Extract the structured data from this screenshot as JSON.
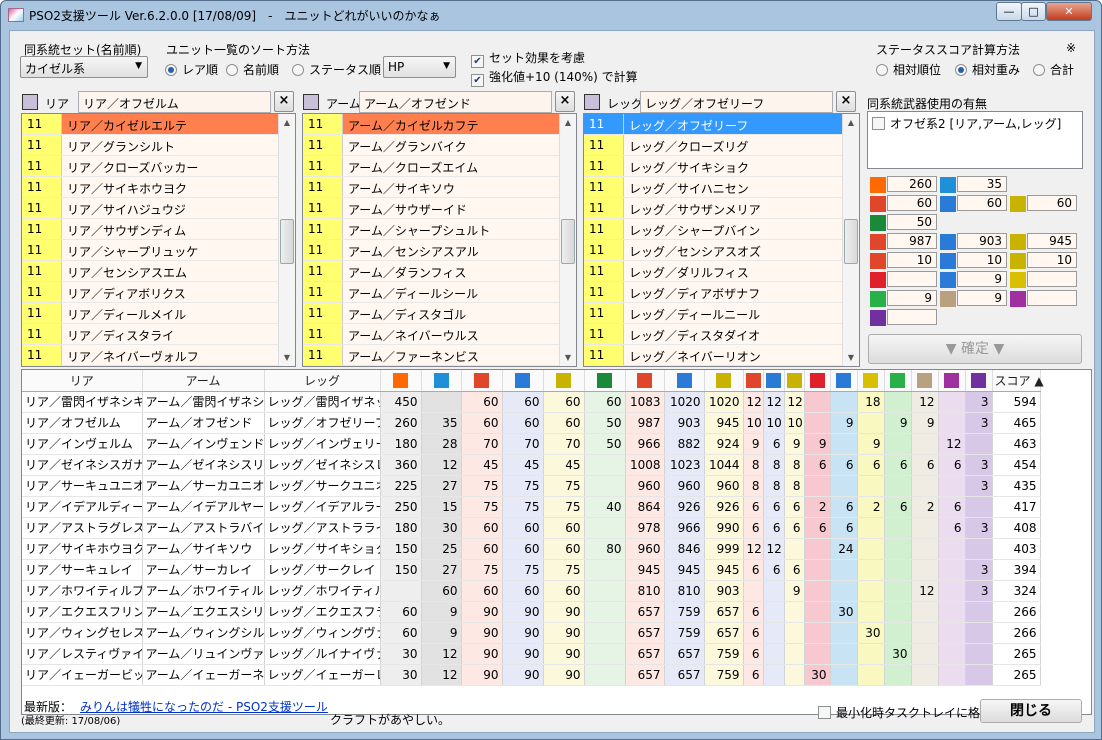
{
  "window": {
    "title": "PSO2支援ツール Ver.6.2.0.0 [17/08/09]　-　ユニットどれがいいのかなぁ",
    "min": "—",
    "max": "□",
    "close": "✕"
  },
  "top": {
    "set_label": "同系統セット(名前順)",
    "set_value": "カイゼル系",
    "sort_label": "ユニット一覧のソート方法",
    "sort_options": [
      "レア順",
      "名前順",
      "ステータス順"
    ],
    "sort_selected": 0,
    "status_value": "HP",
    "opt1": "セット効果を考慮",
    "opt1_checked": true,
    "opt2": "強化値+10 (140%) で計算",
    "opt2_checked": true,
    "score_label": "ステータススコア計算方法",
    "score_note": "※",
    "score_options": [
      "相対順位",
      "相対重み",
      "合計"
    ],
    "score_selected": 1
  },
  "panels": [
    {
      "part": "リア",
      "search": "リア／オフゼルム",
      "selected": 0,
      "sel_style": "orange",
      "items": [
        "リア／カイゼルエルテ",
        "リア／グランシルト",
        "リア／クローズバッカー",
        "リア／サイキホウヨク",
        "リア／サイハジュウジ",
        "リア／サウザンディム",
        "リア／シャープリュッケ",
        "リア／センシアスエム",
        "リア／ディアボリクス",
        "リア／ディールメイル",
        "リア／ディスタライ",
        "リア／ネイバーヴォルフ"
      ]
    },
    {
      "part": "アーム",
      "search": "アーム／オフゼンド",
      "selected": 0,
      "sel_style": "orange",
      "items": [
        "アーム／カイゼルカフテ",
        "アーム／グランバイク",
        "アーム／クローズエイム",
        "アーム／サイキソウ",
        "アーム／サウザーイド",
        "アーム／シャープシュルト",
        "アーム／センシアスアル",
        "アーム／ダランフィス",
        "アーム／ディールシール",
        "アーム／ディスタゴル",
        "アーム／ネイバーウルス",
        "アーム／ファーネンビス"
      ]
    },
    {
      "part": "レッグ",
      "search": "レッグ／オフゼリーフ",
      "selected": 0,
      "sel_style": "blue",
      "items": [
        "レッグ／オフゼリーフ",
        "レッグ／クローズリグ",
        "レッグ／サイキショク",
        "レッグ／サイハニセン",
        "レッグ／サウザンメリア",
        "レッグ／シャープバイン",
        "レッグ／センシアスオズ",
        "レッグ／ダリルフィス",
        "レッグ／ディアボザナフ",
        "レッグ／ディールニール",
        "レッグ／ディスタダイオ",
        "レッグ／ネイバーリオン"
      ]
    }
  ],
  "list_level": "11",
  "weapon": {
    "label": "同系統武器使用の有無",
    "item": "オフゼ系2 [リア,アーム,レッグ]",
    "checked": false
  },
  "stats": {
    "r1": [
      "260",
      "35"
    ],
    "r2": [
      "60",
      "60",
      "60"
    ],
    "r3": [
      "50"
    ],
    "r4": [
      "987",
      "903",
      "945"
    ],
    "r5": [
      "10",
      "10",
      "10"
    ],
    "r6": [
      "",
      "9",
      ""
    ],
    "r7": [
      "9",
      "9",
      ""
    ],
    "r8": [
      ""
    ]
  },
  "confirm_label": "▼ 確定 ▼",
  "table": {
    "headers": [
      "リア",
      "アーム",
      "レッグ"
    ],
    "score_header": "スコア ▲",
    "icon_colors": [
      "#ff6a00",
      "#1e8fd8",
      "#e0462a",
      "#2a7ad8",
      "#c8b400",
      "#1a8a3a",
      "#e0462a",
      "#2a7ad8",
      "#c8b400",
      "#e0462a",
      "#2a7ad8",
      "#c8b400",
      "#e0202a",
      "#2a7ad8",
      "#d8c000",
      "#2ab048",
      "#b8a080",
      "#a030a0",
      "#7030a0"
    ],
    "rows": [
      [
        "リア／雷閃イザネシキ",
        "アーム／雷閃イザネシキ",
        "レッグ／雷閃イザネッチ",
        "450",
        "",
        "60",
        "60",
        "60",
        "60",
        "1083",
        "1020",
        "1020",
        "12",
        "12",
        "12",
        "",
        "",
        "18",
        "",
        "12",
        "",
        "3",
        "594"
      ],
      [
        "リア／オフゼルム",
        "アーム／オフゼンド",
        "レッグ／オフゼリーフ",
        "260",
        "35",
        "60",
        "60",
        "60",
        "50",
        "987",
        "903",
        "945",
        "10",
        "10",
        "10",
        "",
        "9",
        "",
        "9",
        "9",
        "",
        "3",
        "465"
      ],
      [
        "リア／インヴェルム",
        "アーム／インヴェンド",
        "レッグ／インヴェリーフ",
        "180",
        "28",
        "70",
        "70",
        "70",
        "50",
        "966",
        "882",
        "924",
        "9",
        "6",
        "9",
        "9",
        "",
        "9",
        "",
        "",
        "12",
        "",
        "463"
      ],
      [
        "リア／ゼイネシスガナフ",
        "アーム／ゼイネシスリタ",
        "レッグ／ゼイネシスレム",
        "360",
        "12",
        "45",
        "45",
        "45",
        "",
        "1008",
        "1023",
        "1044",
        "8",
        "8",
        "8",
        "6",
        "6",
        "6",
        "6",
        "6",
        "6",
        "3",
        "454"
      ],
      [
        "リア／サーキュユニオン",
        "アーム／サーカユニオン",
        "レッグ／サークユニオン",
        "225",
        "27",
        "75",
        "75",
        "75",
        "",
        "960",
        "960",
        "960",
        "8",
        "8",
        "8",
        "",
        "",
        "",
        "",
        "",
        "",
        "3",
        "435"
      ],
      [
        "リア／イデアルディール",
        "アーム／イデアルヤード",
        "レッグ／イデアルラーナ",
        "250",
        "15",
        "75",
        "75",
        "75",
        "40",
        "864",
        "926",
        "926",
        "6",
        "6",
        "6",
        "2",
        "6",
        "2",
        "6",
        "2",
        "6",
        "",
        "417"
      ],
      [
        "リア／アストラグレス",
        "アーム／アストラバイオ",
        "レッグ／アストラライズ",
        "180",
        "30",
        "60",
        "60",
        "60",
        "",
        "978",
        "966",
        "990",
        "6",
        "6",
        "6",
        "6",
        "6",
        "",
        "",
        "",
        "6",
        "3",
        "408"
      ],
      [
        "リア／サイキホウヨク",
        "アーム／サイキソウ",
        "レッグ／サイキショク",
        "150",
        "25",
        "60",
        "60",
        "60",
        "80",
        "960",
        "846",
        "999",
        "12",
        "12",
        "",
        "",
        "24",
        "",
        "",
        "",
        "",
        "",
        "403"
      ],
      [
        "リア／サーキュレイ",
        "アーム／サーカレイ",
        "レッグ／サークレイ",
        "150",
        "27",
        "75",
        "75",
        "75",
        "",
        "945",
        "945",
        "945",
        "6",
        "6",
        "6",
        "",
        "",
        "",
        "",
        "",
        "",
        "3",
        "394"
      ],
      [
        "リア／ホワイティルプルム",
        "アーム／ホワイティルピナ",
        "レッグ／ホワイティルエア",
        "",
        "60",
        "60",
        "60",
        "60",
        "",
        "810",
        "810",
        "903",
        "",
        "",
        "9",
        "",
        "",
        "",
        "",
        "12",
        "",
        "3",
        "324"
      ],
      [
        "リア／エクエスフリン",
        "アーム／エクエスシリル",
        "レッグ／エクエスフラグ",
        "60",
        "9",
        "90",
        "90",
        "90",
        "",
        "657",
        "759",
        "657",
        "6",
        "",
        "",
        "",
        "30",
        "",
        "",
        "",
        "",
        "",
        "266"
      ],
      [
        "リア／ウィングセレス",
        "アーム／ウィングシルダ",
        "レッグ／ウィングヴァント",
        "60",
        "9",
        "90",
        "90",
        "90",
        "",
        "657",
        "759",
        "657",
        "6",
        "",
        "",
        "",
        "",
        "30",
        "",
        "",
        "",
        "",
        "266"
      ],
      [
        "リア／レスティヴァイゼ",
        "アーム／リュインヴァイゼ",
        "レッグ／ルイナイヴァ…",
        "30",
        "12",
        "90",
        "90",
        "90",
        "",
        "657",
        "657",
        "759",
        "6",
        "",
        "",
        "",
        "",
        "",
        "30",
        "",
        "",
        "",
        "265"
      ],
      [
        "リア／イェーガービッド",
        "アーム／イェーガーネル",
        "レッグ／イェーガーレダ",
        "30",
        "12",
        "90",
        "90",
        "90",
        "",
        "657",
        "657",
        "759",
        "6",
        "",
        "",
        "30",
        "",
        "",
        "",
        "",
        "",
        "",
        "265"
      ]
    ]
  },
  "footer": {
    "latest_label": "最新版：",
    "link": "みりんは犠牲になったのだ - PSO2支援ツール",
    "updated": "(最終更新: 17/08/06)",
    "note": "クラフトがあやしい。",
    "tray": "最小化時タスクトレイに格納",
    "close": "閉じる"
  }
}
